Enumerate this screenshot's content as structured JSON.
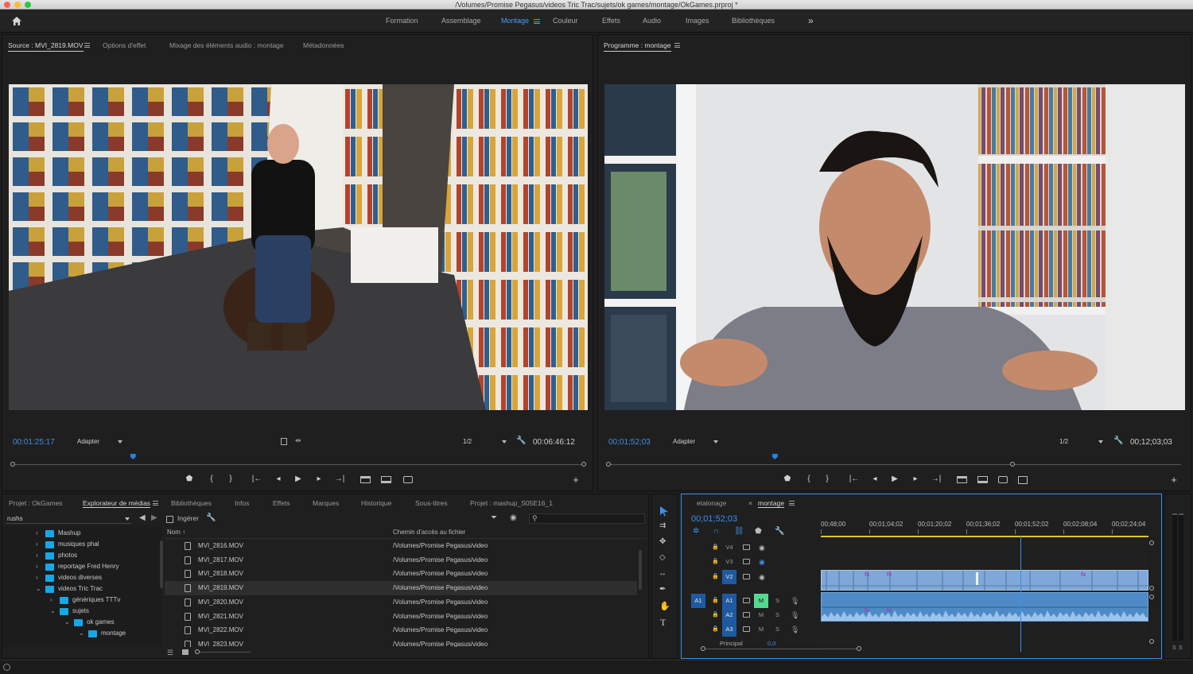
{
  "window": {
    "title": "/Volumes/Promise Pegasus/videos Tric Trac/sujets/ok games/montage/OkGames.prproj *"
  },
  "workspaces": [
    {
      "label": "Formation",
      "active": false
    },
    {
      "label": "Assemblage",
      "active": false
    },
    {
      "label": "Montage",
      "active": true
    },
    {
      "label": "Couleur",
      "active": false
    },
    {
      "label": "Effets",
      "active": false
    },
    {
      "label": "Audio",
      "active": false
    },
    {
      "label": "Images",
      "active": false
    },
    {
      "label": "Bibliothèques",
      "active": false
    }
  ],
  "more_glyph": "»",
  "source": {
    "tabs": [
      "Source : MVI_2819.MOV",
      "Options d'effet",
      "Mixage des éléments audio : montage",
      "Métadonnées"
    ],
    "timecode": "00:01:25:17",
    "fit": "Adapter",
    "resolution": "1/2",
    "duration": "00:06:46:12",
    "playhead_fraction": 0.21
  },
  "program": {
    "tabs": [
      "Programme : montage"
    ],
    "timecode": "00;01;52;03",
    "fit": "Adapter",
    "resolution": "1/2",
    "duration": "00;12;03;03",
    "playhead_fraction": 0.29
  },
  "transport": {
    "marker": "⬟",
    "in": "{",
    "out": "}",
    "goto_in": "|←",
    "step_back": "◂",
    "play": "▶",
    "step_fwd": "▸",
    "goto_out": "→|",
    "add": "+"
  },
  "project": {
    "tabs": [
      "Projet : OkGames",
      "Explorateur de médias",
      "Bibliothèques",
      "Infos",
      "Effets",
      "Marques",
      "Historique",
      "Sous-titres",
      "Projet : mashup_S05E16_1"
    ],
    "location": "rushs",
    "ingest_label": "Ingérer",
    "columns": [
      "Nom ↑",
      "Chemin d'accès au fichier"
    ],
    "tree": [
      {
        "label": "Mashup",
        "depth": 0,
        "open": false
      },
      {
        "label": "musiques phal",
        "depth": 0,
        "open": false
      },
      {
        "label": "photos",
        "depth": 0,
        "open": false
      },
      {
        "label": "reportage Fred Henry",
        "depth": 0,
        "open": false
      },
      {
        "label": "videos diverses",
        "depth": 0,
        "open": false
      },
      {
        "label": "videos Tric Trac",
        "depth": 0,
        "open": true
      },
      {
        "label": "génériques TTTv",
        "depth": 1,
        "open": false
      },
      {
        "label": "sujets",
        "depth": 1,
        "open": true
      },
      {
        "label": "ok games",
        "depth": 2,
        "open": true
      },
      {
        "label": "montage",
        "depth": 3,
        "open": true
      }
    ],
    "files": [
      {
        "name": "MVI_2816.MOV",
        "path": "/Volumes/Promise Pegasus/video"
      },
      {
        "name": "MVI_2817.MOV",
        "path": "/Volumes/Promise Pegasus/video"
      },
      {
        "name": "MVI_2818.MOV",
        "path": "/Volumes/Promise Pegasus/video"
      },
      {
        "name": "MVI_2819.MOV",
        "path": "/Volumes/Promise Pegasus/video",
        "selected": true
      },
      {
        "name": "MVI_2820.MOV",
        "path": "/Volumes/Promise Pegasus/video"
      },
      {
        "name": "MVI_2821.MOV",
        "path": "/Volumes/Promise Pegasus/video"
      },
      {
        "name": "MVI_2822.MOV",
        "path": "/Volumes/Promise Pegasus/video"
      },
      {
        "name": "MVI_2823.MOV",
        "path": "/Volumes/Promise Pegasus/video"
      }
    ]
  },
  "timeline": {
    "tabs": [
      "etalonage",
      "montage"
    ],
    "close_glyph": "×",
    "timecode": "00;01;52;03",
    "ruler": [
      "00;48;00",
      "00;01;04;02",
      "00;01;20;02",
      "00;01;36;02",
      "00;01;52;02",
      "00;02;08;04",
      "00;02;24;04"
    ],
    "playhead_fraction": 0.61,
    "video_tracks": [
      {
        "label": "V4"
      },
      {
        "label": "V3"
      },
      {
        "label": "V2",
        "targeted": true
      }
    ],
    "audio_tracks": [
      {
        "label": "A1",
        "source": "A1",
        "mute": true
      },
      {
        "label": "A2",
        "source": "",
        "mute": false
      },
      {
        "label": "A3",
        "source": "",
        "mute": false
      }
    ],
    "mute_label": "M",
    "solo_label": "S",
    "v1_label": "V1",
    "master_label": "Principal",
    "master_value": "0,0",
    "fx_label": "fx"
  },
  "meter": {
    "labels": [
      "S",
      "S"
    ]
  },
  "colors": {
    "accent": "#3d8fe8",
    "clip_video": "#7fa8d8",
    "clip_audio": "#4e8bc6",
    "folder": "#15a8e8",
    "mute_on": "#54d98f"
  }
}
